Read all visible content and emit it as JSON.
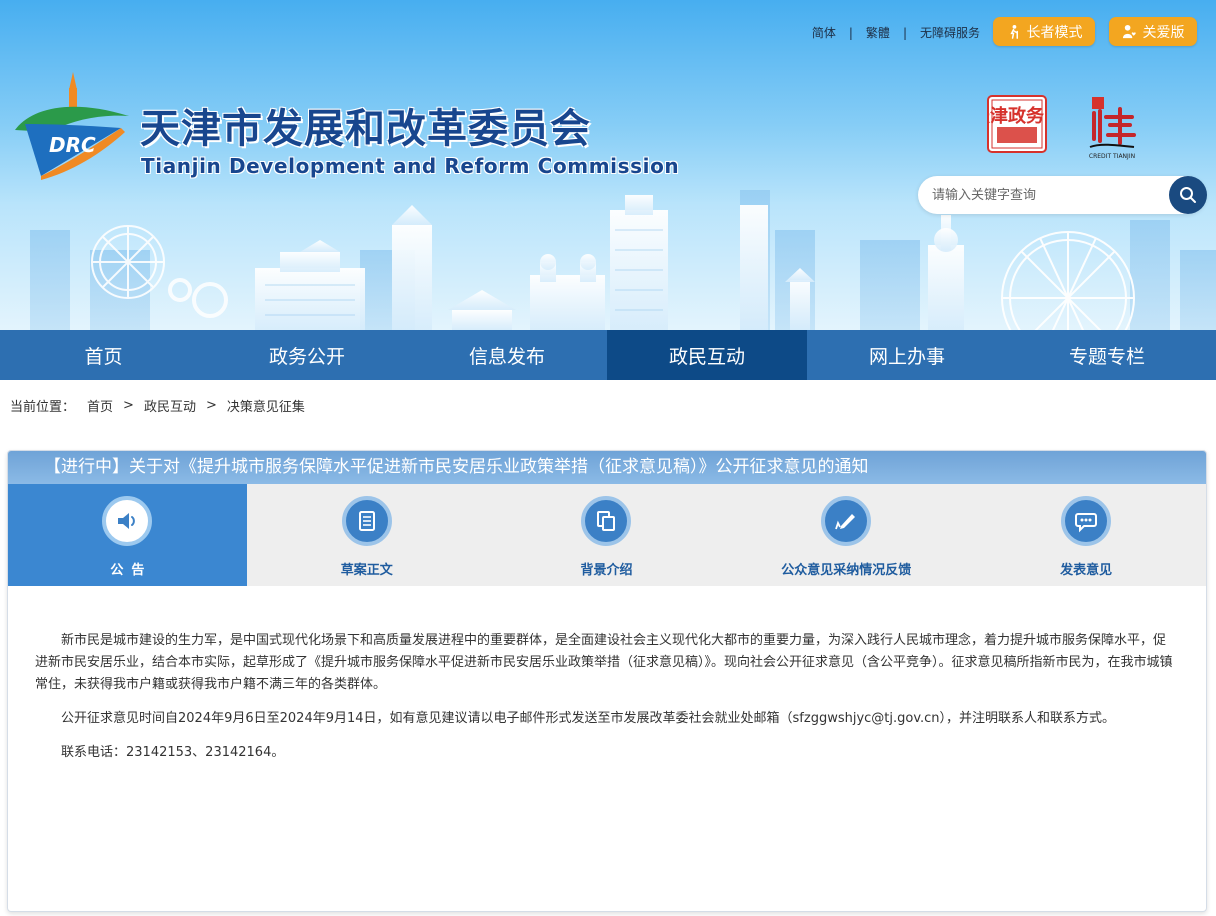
{
  "header": {
    "top_links": [
      "简体",
      "繁體",
      "无障碍服务"
    ],
    "elder_mode": "长者模式",
    "care_mode": "关爱版",
    "logo_text": "DRC",
    "title": "天津市发展和改革委员会",
    "subtitle": "Tianjin Development and Reform Commission",
    "seal_text": "天津政务网",
    "credit_text": "CREDIT TIANJIN",
    "search_placeholder": "请输入关键字查询"
  },
  "nav": {
    "items": [
      "首页",
      "政务公开",
      "信息发布",
      "政民互动",
      "网上办事",
      "专题专栏"
    ],
    "active": "政民互动"
  },
  "breadcrumb": {
    "label": "当前位置：",
    "items": [
      "首页",
      "政民互动",
      "决策意见征集"
    ],
    "separator": ">"
  },
  "panel": {
    "title": "【进行中】关于对《提升城市服务保障水平促进新市民安居乐业政策举措（征求意见稿）》公开征求意见的通知",
    "tabs": [
      "公告",
      "草案正文",
      "背景介绍",
      "公众意见采纳情况反馈",
      "发表意见"
    ],
    "active_tab": "公告",
    "paragraphs": [
      "新市民是城市建设的生力军，是中国式现代化场景下和高质量发展进程中的重要群体，是全面建设社会主义现代化大都市的重要力量，为深入践行人民城市理念，着力提升城市服务保障水平，促进新市民安居乐业，结合本市实际，起草形成了《提升城市服务保障水平促进新市民安居乐业政策举措（征求意见稿）》。现向社会公开征求意见（含公平竞争）。征求意见稿所指新市民为，在我市城镇常住，未获得我市户籍或获得我市户籍不满三年的各类群体。",
      "公开征求意见时间自2024年9月6日至2024年9月14日，如有意见建议请以电子邮件形式发送至市发展改革委社会就业处邮箱（sfzggwshjyc@tj.gov.cn），并注明联系人和联系方式。",
      "联系电话：23142153、23142164。"
    ]
  },
  "colors": {
    "nav_bg": "#2d6fb1",
    "nav_active": "#0d4a87",
    "mode_button": "#f3a620",
    "title_blue": "#18468e",
    "tab_active": "#3b87d1"
  }
}
